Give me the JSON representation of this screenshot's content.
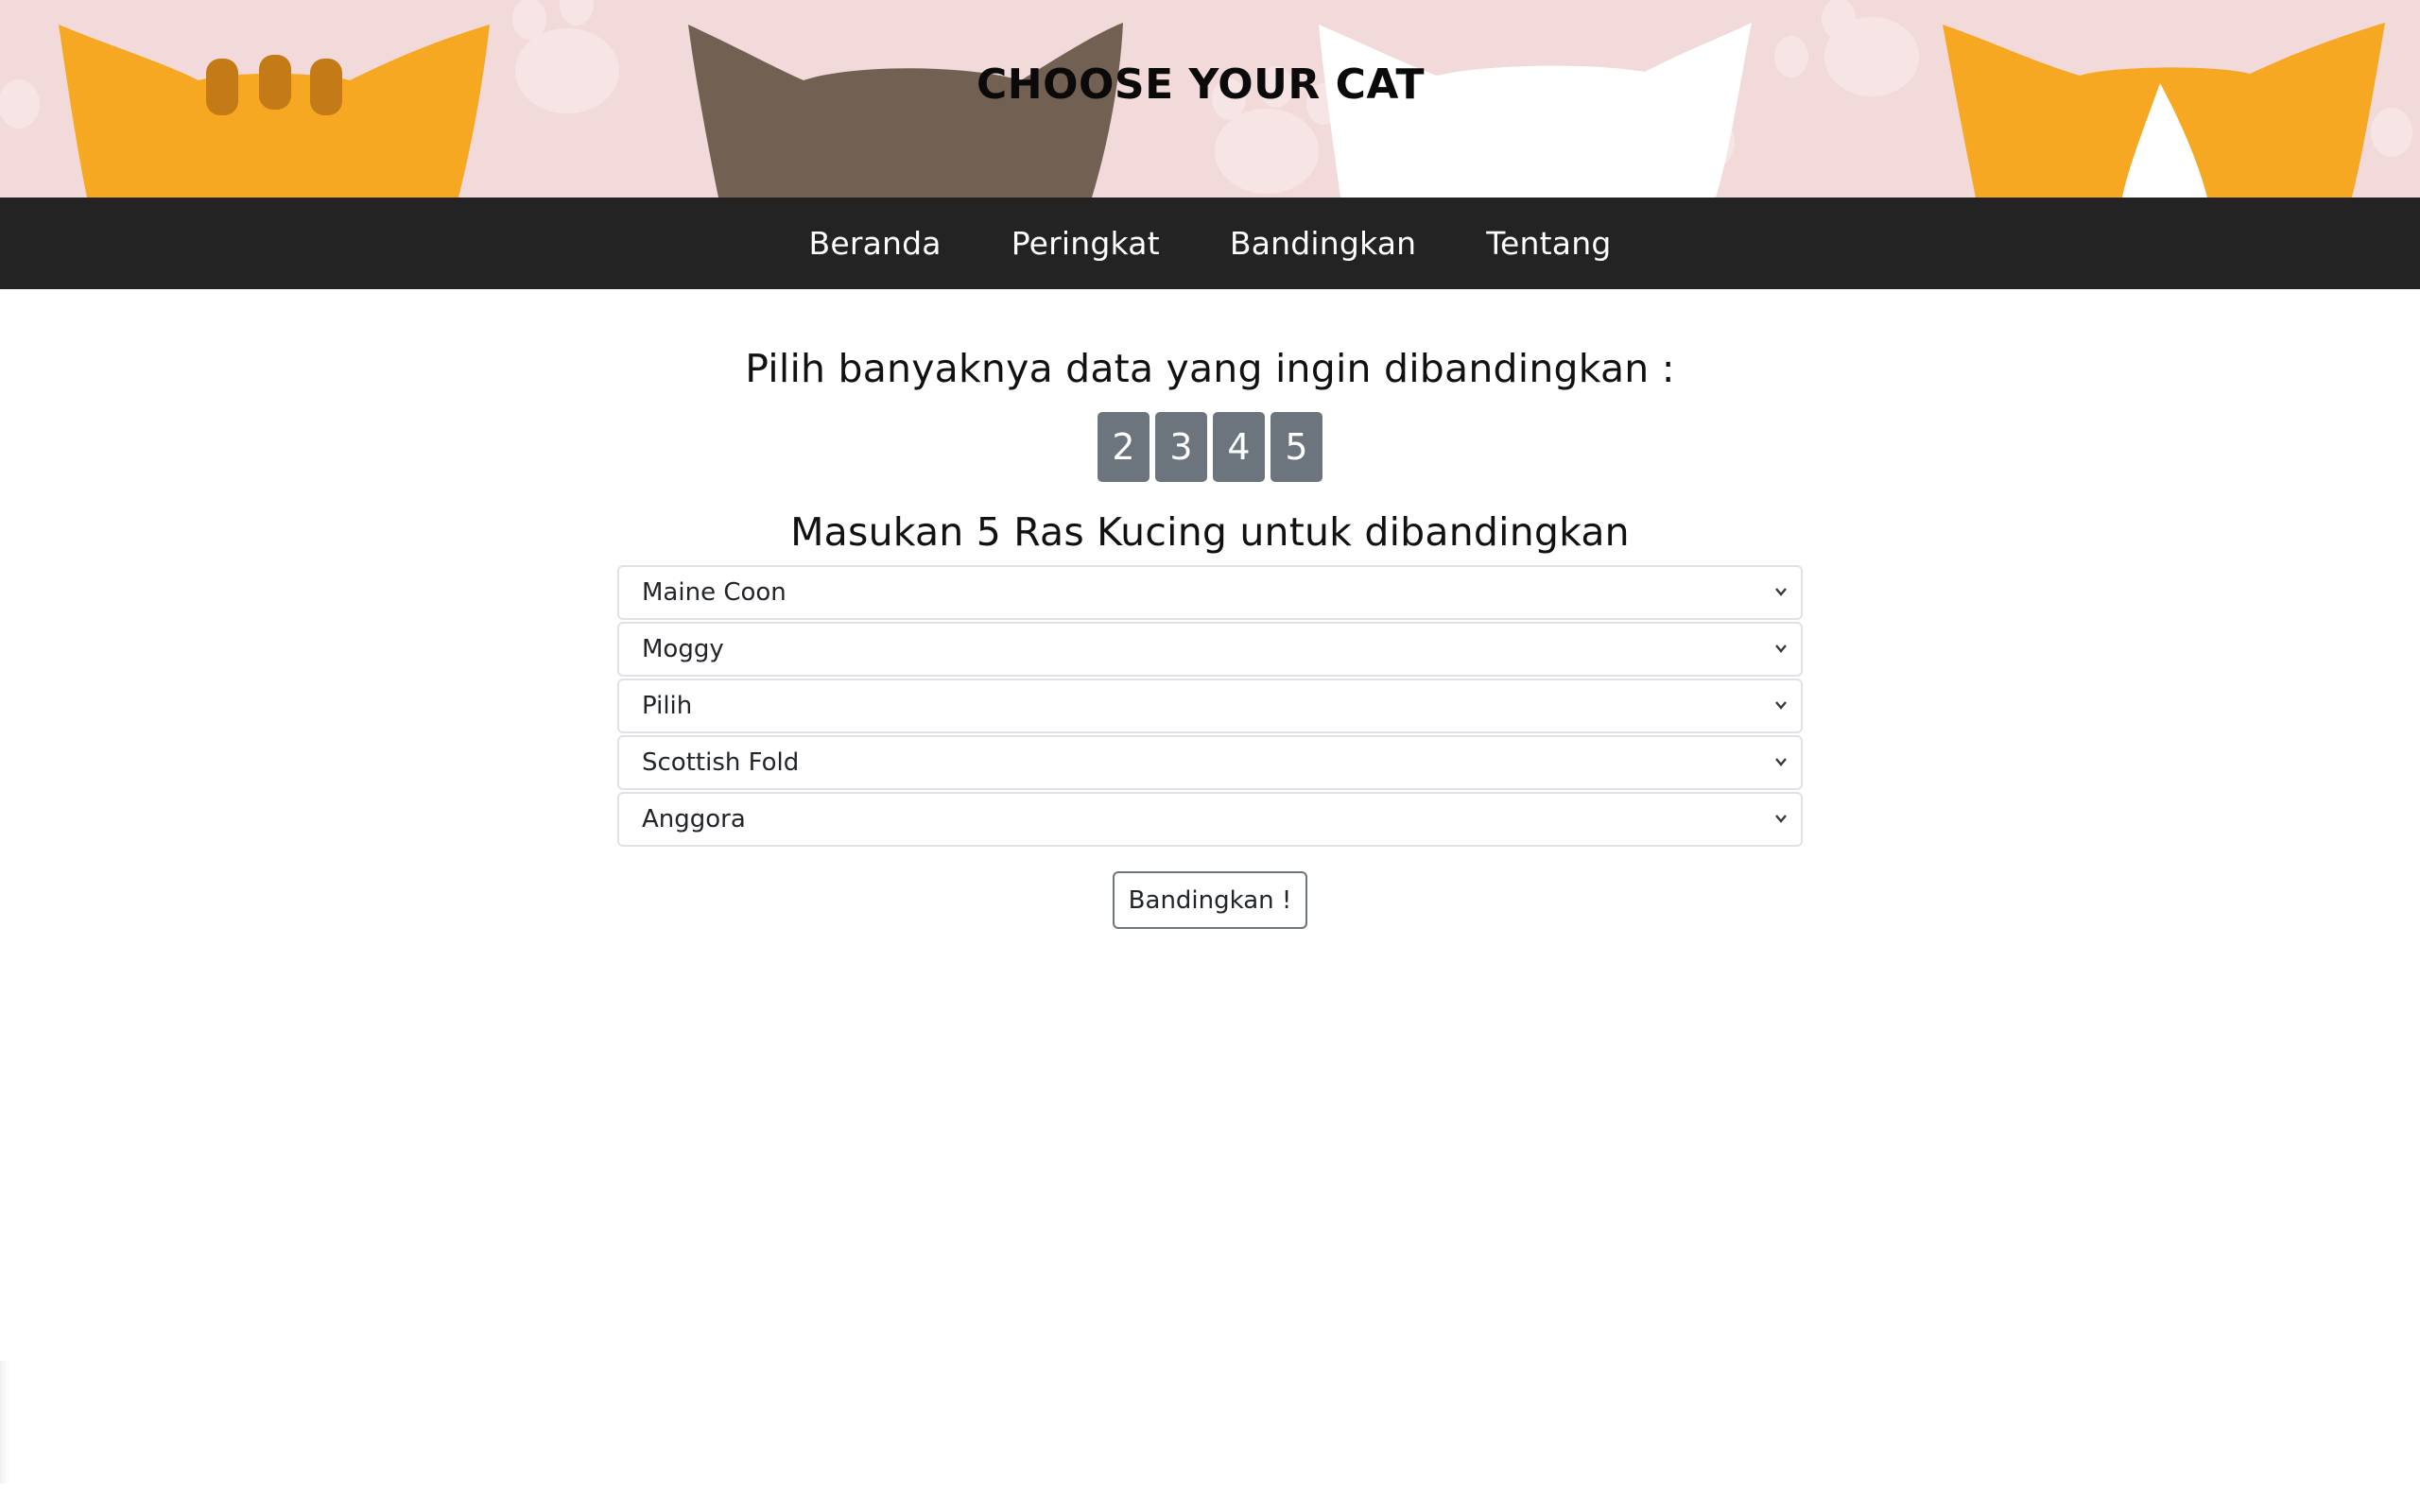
{
  "header": {
    "title": "CHOOSE YOUR CAT",
    "colors": {
      "banner_bg": "#f2dadb",
      "orange": "#f7a823",
      "brown": "#726152",
      "white": "#ffffff",
      "stripe": "#c37a17"
    }
  },
  "nav": {
    "items": [
      {
        "label": "Beranda"
      },
      {
        "label": "Peringkat"
      },
      {
        "label": "Bandingkan"
      },
      {
        "label": "Tentang"
      }
    ],
    "bg": "#232323"
  },
  "compare": {
    "count_prompt": "Pilih banyaknya data yang ingin dibandingkan :",
    "count_options": [
      "2",
      "3",
      "4",
      "5"
    ],
    "breed_prompt": "Masukan 5 Ras Kucing untuk dibandingkan",
    "selects": [
      {
        "value": "Maine Coon"
      },
      {
        "value": "Moggy"
      },
      {
        "value": "Pilih"
      },
      {
        "value": "Scottish Fold"
      },
      {
        "value": "Anggora"
      }
    ],
    "submit_label": "Bandingkan !"
  }
}
